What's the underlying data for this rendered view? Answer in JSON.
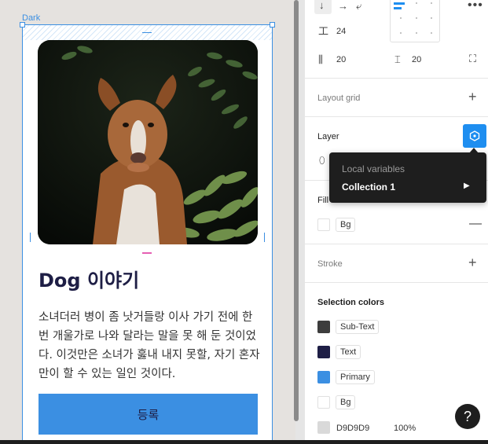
{
  "canvas": {
    "frame_label": "Dark",
    "card": {
      "title": "Dog 이야기",
      "body": "소녀더러 병이 좀 낫거들랑 이사 가기 전에 한 번 개울가로 나와 달라는 말을 못 해 둔 것이었다. 이것만은 소녀가 훓내 내지 못할, 자기 혼자만이 할 수 있는 일인 것이다.",
      "button_label": "등록",
      "photo_subject": "dog-photo"
    }
  },
  "panel": {
    "auto_layout": {
      "gap": "24",
      "padding_horizontal": "20",
      "padding_vertical": "20"
    },
    "layout_grid": {
      "label": "Layout grid"
    },
    "layer": {
      "label": "Layer"
    },
    "fill": {
      "label": "Fill",
      "style_name": "Bg"
    },
    "stroke": {
      "label": "Stroke"
    },
    "selection_colors": {
      "label": "Selection colors",
      "items": [
        {
          "name": "Sub-Text",
          "color": "#3d3d3d"
        },
        {
          "name": "Text",
          "color": "#1e1e45"
        },
        {
          "name": "Primary",
          "color": "#3b8fe2"
        },
        {
          "name": "Bg",
          "color": "#ffffff"
        }
      ],
      "raw": {
        "hex": "D9D9D9",
        "opacity": "100%",
        "color": "#d9d9d9"
      }
    },
    "popup": {
      "heading": "Local variables",
      "item": "Collection 1"
    }
  },
  "help": {
    "label": "?"
  }
}
